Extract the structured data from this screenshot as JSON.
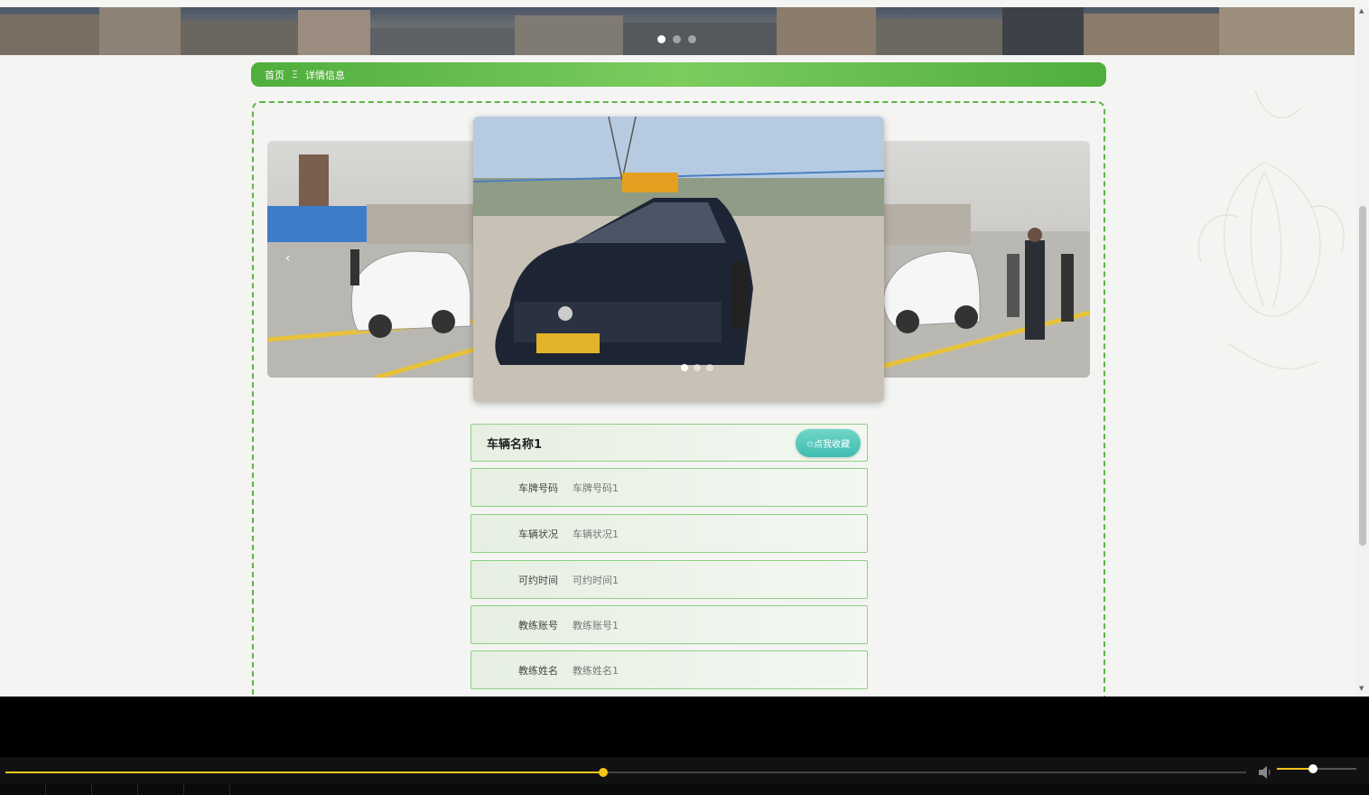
{
  "banner": {
    "slide_count": 3,
    "active_slide": 0
  },
  "breadcrumb": {
    "home": "首页",
    "separator": "Ξ",
    "current": "详情信息"
  },
  "carousel": {
    "prev_label": "‹",
    "slide_count": 3,
    "active_slide": 0
  },
  "detail": {
    "title": "车辆名称1",
    "favorite_label": "✩点我收藏",
    "fields": [
      {
        "label": "车牌号码",
        "value": "车牌号码1"
      },
      {
        "label": "车辆状况",
        "value": "车辆状况1"
      },
      {
        "label": "可约时间",
        "value": "可约时间1"
      },
      {
        "label": "教练账号",
        "value": "教练账号1"
      },
      {
        "label": "教练姓名",
        "value": "教练姓名1"
      }
    ]
  },
  "player": {
    "progress": 0.482,
    "volume": 0.45
  },
  "colors": {
    "accent_green": "#4fae3c",
    "favorite_teal": "#3fbcb1",
    "seek_yellow": "#f5c518"
  }
}
